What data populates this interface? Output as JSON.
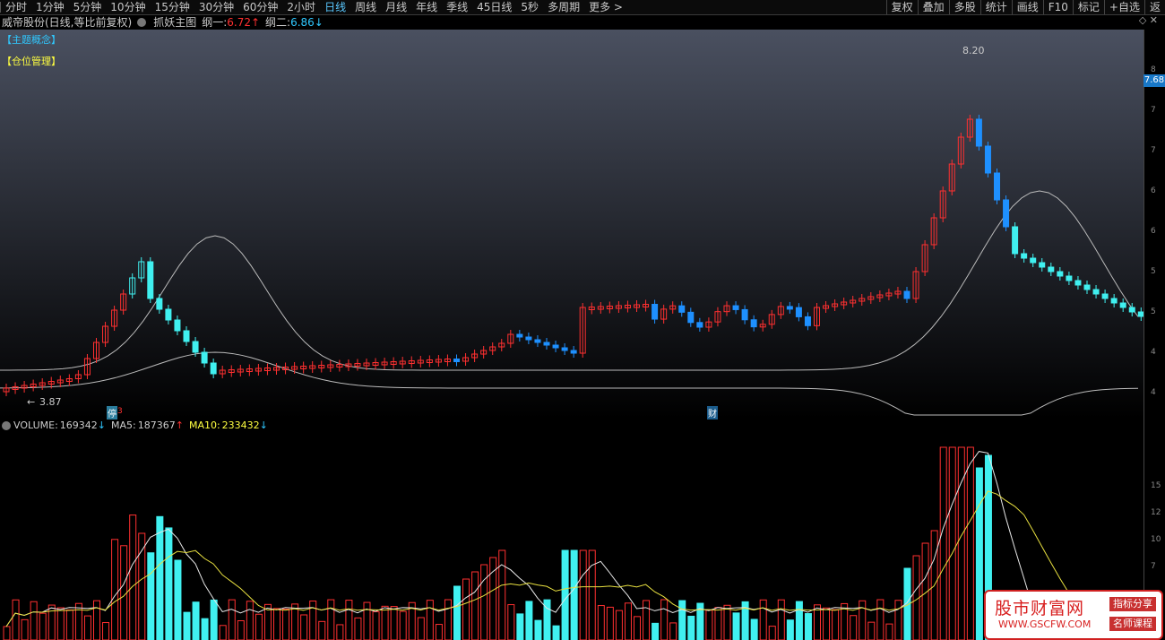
{
  "toolbar": {
    "timeframes": [
      "分时",
      "1分钟",
      "5分钟",
      "10分钟",
      "15分钟",
      "30分钟",
      "60分钟",
      "2小时",
      "日线",
      "周线",
      "月线",
      "年线",
      "季线",
      "45日线",
      "5秒",
      "多周期",
      "更多"
    ],
    "active": "日线",
    "tools": [
      "复权",
      "叠加",
      "多股",
      "统计",
      "画线",
      "F10",
      "标记",
      "+自选",
      "返"
    ]
  },
  "title": {
    "stock": "威帝股份(日线,等比前复权)",
    "indicator": "抓妖主图",
    "line1_label": "纲一:",
    "line1_value": "6.72",
    "line2_label": "纲二:",
    "line2_value": "6.86"
  },
  "labels": {
    "theme": "【主题概念】",
    "position": "【仓位管理】",
    "high_label": "8.20",
    "low_label": "3.87",
    "limit_mark": "停",
    "limit_mark2": "3",
    "cai_mark": "财"
  },
  "price_tag": "7.68",
  "price_axis": [
    "8",
    "7",
    "6",
    "5",
    "4"
  ],
  "volume": {
    "vol_label": "VOLUME:",
    "vol_value": "169342",
    "ma5_label": "MA5:",
    "ma5_value": "187367",
    "ma10_label": "MA10:",
    "ma10_value": "233432",
    "axis": [
      "15",
      "12",
      "10",
      "7"
    ]
  },
  "watermark": {
    "title": "股市财富网",
    "url": "WWW.GSCFW.COM",
    "tag1": "指标分享",
    "tag2": "名师课程"
  },
  "colors": {
    "up": "#ff3030",
    "down": "#1e90ff",
    "cyan": "#40f0f0",
    "yellow": "#ffe000",
    "orange": "#d29a3c"
  }
}
